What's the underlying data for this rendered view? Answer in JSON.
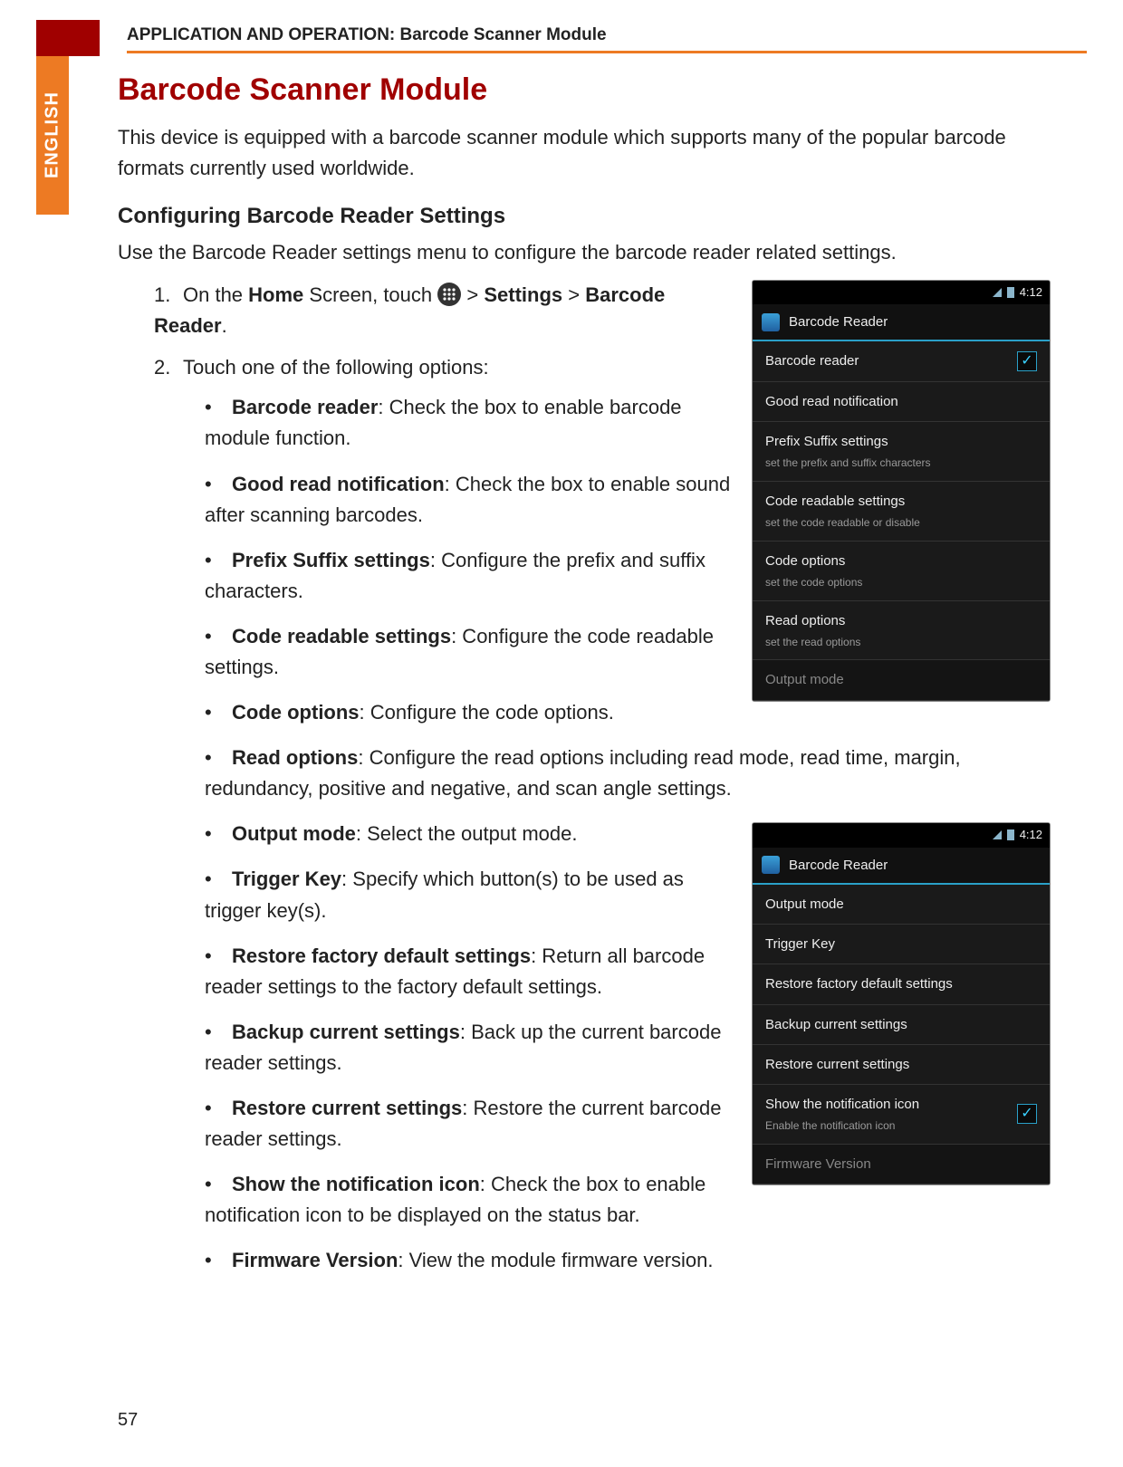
{
  "header": {
    "running_title": "APPLICATION AND OPERATION: Barcode Scanner Module",
    "language_tab": "ENGLISH"
  },
  "title": "Barcode Scanner Module",
  "intro": "This device is equipped with a barcode scanner module which supports many of the popular barcode formats currently used worldwide.",
  "subhead": "Configuring Barcode Reader Settings",
  "lead": "Use the Barcode Reader settings menu to configure the barcode reader related settings.",
  "steps": {
    "s1_pre": "On the ",
    "s1_home": "Home",
    "s1_mid": " Screen, touch ",
    "s1_gt": "  > ",
    "s1_settings": "Settings",
    "s1_gt2": " > ",
    "s1_br": "Barcode Reader",
    "s1_end": ".",
    "s2": "Touch one of the following options:"
  },
  "options": [
    {
      "name": "Barcode reader",
      "desc": ": Check the box to enable barcode module function."
    },
    {
      "name": "Good read notification",
      "desc": ": Check the box to enable sound after scanning barcodes."
    },
    {
      "name": "Prefix Suffix settings",
      "desc": ": Configure the prefix and suffix characters."
    },
    {
      "name": "Code readable settings",
      "desc": ": Configure the code readable settings."
    },
    {
      "name": "Code options",
      "desc": ": Configure the code options."
    },
    {
      "name": "Read options",
      "desc": ": Configure the read options including read mode, read time, margin, redundancy, positive and negative, and scan angle settings."
    },
    {
      "name": "Output mode",
      "desc": ": Select the output mode."
    },
    {
      "name": "Trigger Key",
      "desc": ": Specify which button(s) to be used as trigger key(s)."
    },
    {
      "name": "Restore factory default settings",
      "desc": ": Return all barcode reader settings to the factory default settings."
    },
    {
      "name": "Backup current settings",
      "desc": ": Back up the current barcode reader settings."
    },
    {
      "name": "Restore current settings",
      "desc": ": Restore the current barcode reader settings."
    },
    {
      "name": "Show the notification icon",
      "desc": ": Check the box to enable notification icon to be displayed on the status bar."
    },
    {
      "name": "Firmware Version",
      "desc": ": View the module firmware version."
    }
  ],
  "phone1": {
    "time": "4:12",
    "title": "Barcode Reader",
    "rows": [
      {
        "label": "Barcode reader",
        "sub": "",
        "checked": true
      },
      {
        "label": "Good read notification",
        "sub": ""
      },
      {
        "label": "Prefix Suffix settings",
        "sub": "set the prefix and suffix characters"
      },
      {
        "label": "Code readable settings",
        "sub": "set the code readable or disable"
      },
      {
        "label": "Code options",
        "sub": "set the code options"
      },
      {
        "label": "Read options",
        "sub": "set the read options"
      },
      {
        "label": "Output mode",
        "sub": "",
        "dim": true
      }
    ]
  },
  "phone2": {
    "time": "4:12",
    "title": "Barcode Reader",
    "rows": [
      {
        "label": "Output mode",
        "sub": ""
      },
      {
        "label": "Trigger Key",
        "sub": ""
      },
      {
        "label": "Restore factory default settings",
        "sub": ""
      },
      {
        "label": "Backup current settings",
        "sub": ""
      },
      {
        "label": "Restore current settings",
        "sub": ""
      },
      {
        "label": "Show the notification icon",
        "sub": "Enable the notification icon",
        "checked": true
      },
      {
        "label": "Firmware Version",
        "sub": "",
        "dim": true
      }
    ]
  },
  "page_number": "57"
}
